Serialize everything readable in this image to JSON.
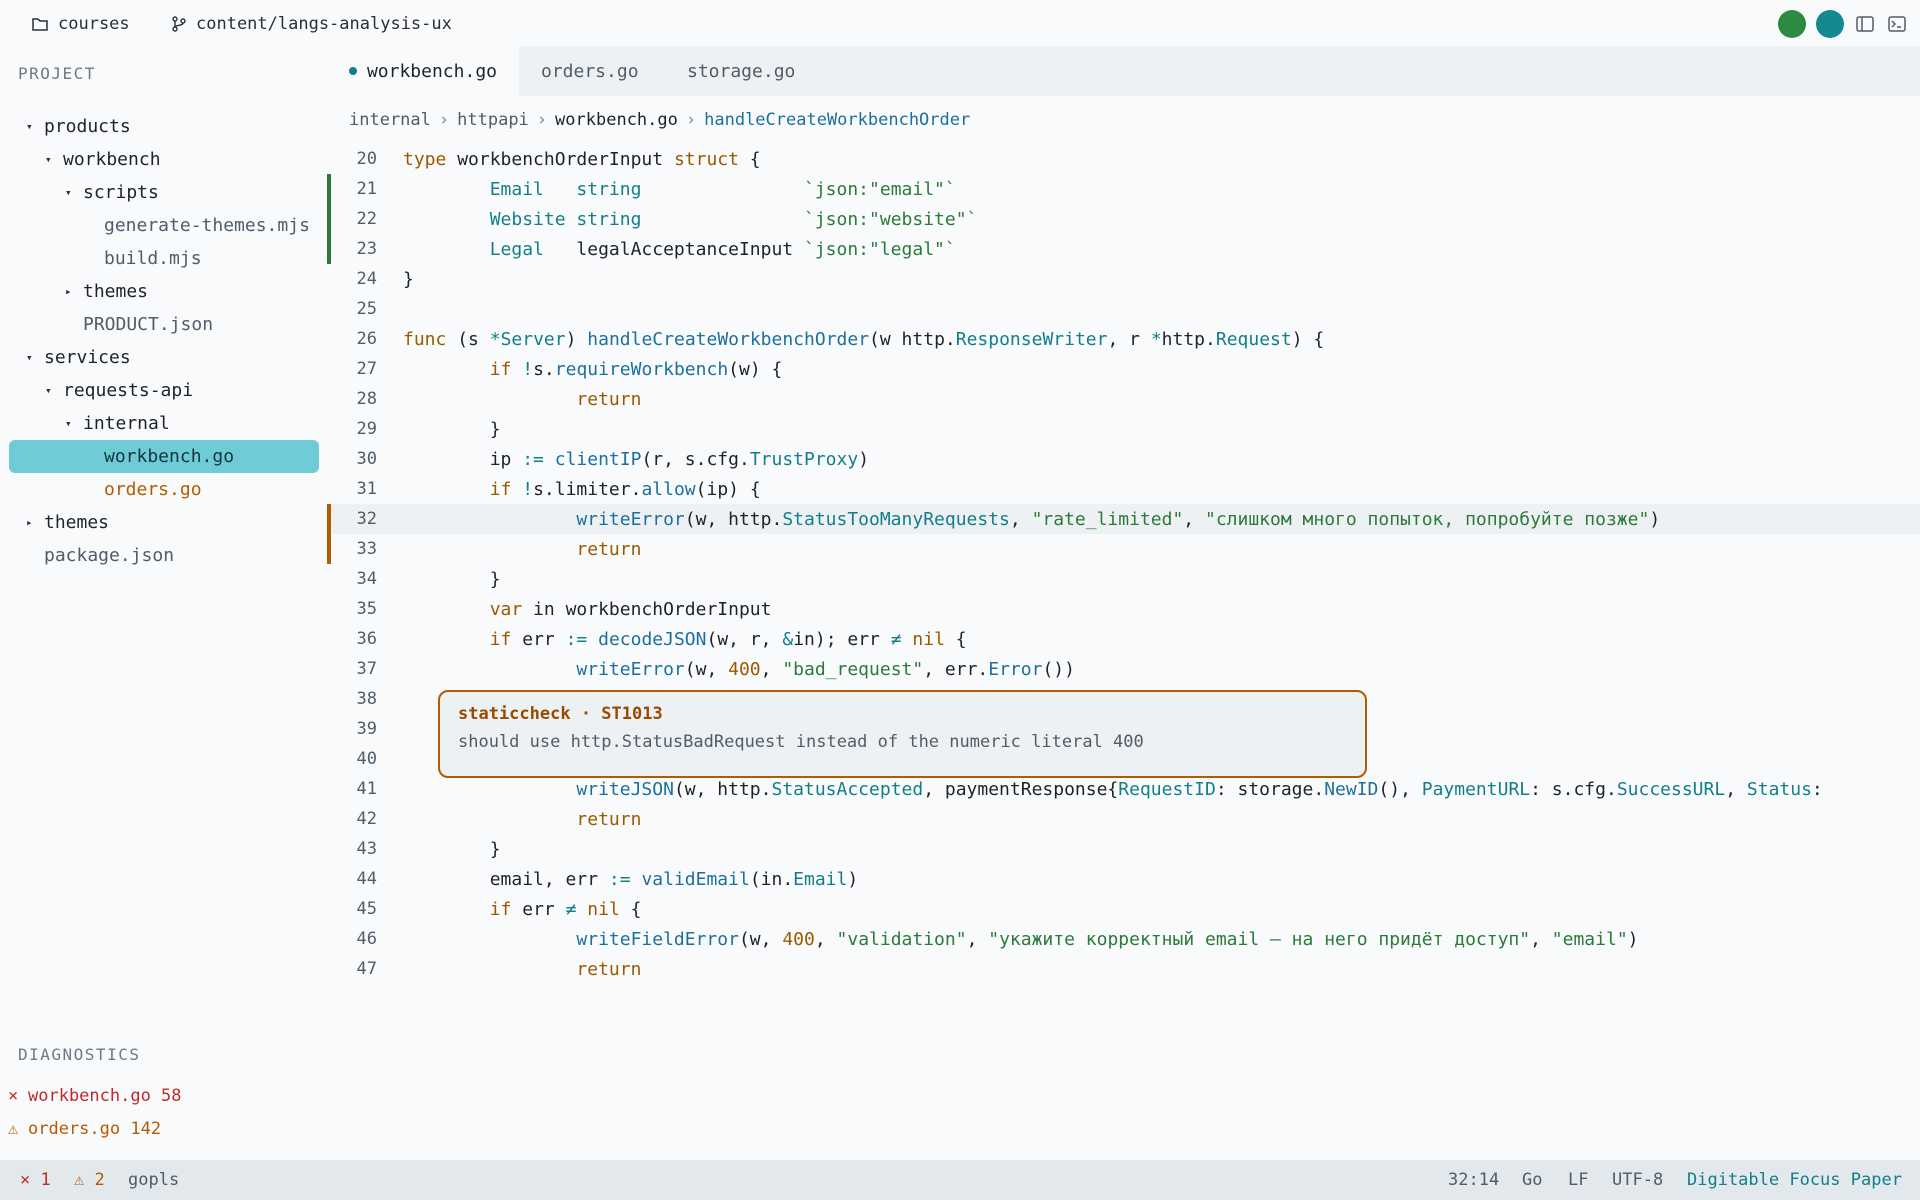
{
  "topbar": {
    "project": "courses",
    "branch": "content/langs-analysis-ux",
    "avatar_colors": [
      "#2e8a3e",
      "#138a92"
    ]
  },
  "sidebar": {
    "project_title": "PROJECT",
    "tree": [
      {
        "label": "products",
        "caret": "▾",
        "kind": "folder"
      },
      {
        "label": "workbench",
        "caret": "▾",
        "kind": "folder"
      },
      {
        "label": "scripts",
        "caret": "▾",
        "kind": "folder"
      },
      {
        "label": "generate-themes.mjs",
        "caret": "",
        "kind": "file"
      },
      {
        "label": "build.mjs",
        "caret": "",
        "kind": "file"
      },
      {
        "label": "themes",
        "caret": "▸",
        "kind": "folder"
      },
      {
        "label": "PRODUCT.json",
        "caret": "",
        "kind": "file"
      },
      {
        "label": "services",
        "caret": "▾",
        "kind": "folder"
      },
      {
        "label": "requests-api",
        "caret": "▾",
        "kind": "folder"
      },
      {
        "label": "internal",
        "caret": "▾",
        "kind": "folder"
      },
      {
        "label": "workbench.go",
        "caret": "",
        "kind": "selected"
      },
      {
        "label": "orders.go",
        "caret": "",
        "kind": "warn"
      },
      {
        "label": "themes",
        "caret": "▸",
        "kind": "folder"
      },
      {
        "label": "package.json",
        "caret": "",
        "kind": "file"
      }
    ],
    "diagnostics_title": "DIAGNOSTICS",
    "diagnostics": [
      {
        "symbol": "×",
        "text": "workbench.go 58",
        "severity": "error"
      },
      {
        "symbol": "⚠",
        "text": "orders.go 142",
        "severity": "warning"
      }
    ]
  },
  "tabs": [
    {
      "label": "workbench.go",
      "active": true,
      "modified": true
    },
    {
      "label": "orders.go",
      "active": false,
      "modified": false
    },
    {
      "label": "storage.go",
      "active": false,
      "modified": false
    }
  ],
  "breadcrumb": {
    "parts": [
      "internal",
      "httpapi",
      "workbench.go"
    ],
    "symbol": "handleCreateWorkbenchOrder",
    "sep": "›"
  },
  "code_lines": [
    {
      "n": 20,
      "tokens": [
        [
          "kw",
          "type"
        ],
        [
          "pl",
          " workbenchOrderInput "
        ],
        [
          "kw",
          "struct"
        ],
        [
          "pl",
          " {"
        ]
      ]
    },
    {
      "n": 21,
      "mark": "added",
      "tokens": [
        [
          "pl",
          "        "
        ],
        [
          "ty",
          "Email"
        ],
        [
          "pl",
          "   "
        ],
        [
          "ty",
          "string"
        ],
        [
          "pl",
          "               "
        ],
        [
          "st",
          "`json:\"email\"`"
        ]
      ]
    },
    {
      "n": 22,
      "mark": "added",
      "tokens": [
        [
          "pl",
          "        "
        ],
        [
          "ty",
          "Website"
        ],
        [
          "pl",
          " "
        ],
        [
          "ty",
          "string"
        ],
        [
          "pl",
          "               "
        ],
        [
          "st",
          "`json:\"website\"`"
        ]
      ]
    },
    {
      "n": 23,
      "mark": "added",
      "tokens": [
        [
          "pl",
          "        "
        ],
        [
          "ty",
          "Legal"
        ],
        [
          "pl",
          "   legalAcceptanceInput "
        ],
        [
          "st",
          "`json:\"legal\"`"
        ]
      ]
    },
    {
      "n": 24,
      "tokens": [
        [
          "pl",
          "}"
        ]
      ]
    },
    {
      "n": 25,
      "tokens": []
    },
    {
      "n": 26,
      "tokens": [
        [
          "kw",
          "func"
        ],
        [
          "pl",
          " (s "
        ],
        [
          "op",
          "*"
        ],
        [
          "ty",
          "Server"
        ],
        [
          "pl",
          ") "
        ],
        [
          "fn",
          "handleCreateWorkbenchOrder"
        ],
        [
          "pl",
          "(w http."
        ],
        [
          "ty",
          "ResponseWriter"
        ],
        [
          "pl",
          ", r "
        ],
        [
          "op",
          "*"
        ],
        [
          "pl",
          "http."
        ],
        [
          "ty",
          "Request"
        ],
        [
          "pl",
          ") {"
        ]
      ]
    },
    {
      "n": 27,
      "tokens": [
        [
          "pl",
          "        "
        ],
        [
          "kw",
          "if"
        ],
        [
          "pl",
          " "
        ],
        [
          "op",
          "!"
        ],
        [
          "pl",
          "s."
        ],
        [
          "fn",
          "requireWorkbench"
        ],
        [
          "pl",
          "(w) {"
        ]
      ]
    },
    {
      "n": 28,
      "tokens": [
        [
          "pl",
          "                "
        ],
        [
          "kw",
          "return"
        ]
      ]
    },
    {
      "n": 29,
      "tokens": [
        [
          "pl",
          "        }"
        ]
      ]
    },
    {
      "n": 30,
      "tokens": [
        [
          "pl",
          "        ip "
        ],
        [
          "op",
          ":="
        ],
        [
          "pl",
          " "
        ],
        [
          "fn",
          "clientIP"
        ],
        [
          "pl",
          "(r, s.cfg."
        ],
        [
          "ty",
          "TrustProxy"
        ],
        [
          "pl",
          ")"
        ]
      ]
    },
    {
      "n": 31,
      "tokens": [
        [
          "pl",
          "        "
        ],
        [
          "kw",
          "if"
        ],
        [
          "pl",
          " "
        ],
        [
          "op",
          "!"
        ],
        [
          "pl",
          "s.limiter."
        ],
        [
          "fn",
          "allow"
        ],
        [
          "pl",
          "(ip) {"
        ]
      ]
    },
    {
      "n": 32,
      "mark": "modified",
      "highlight": true,
      "tokens": [
        [
          "pl",
          "                "
        ],
        [
          "fn",
          "writeError"
        ],
        [
          "pl",
          "(w, http."
        ],
        [
          "ty",
          "StatusTooManyRequests"
        ],
        [
          "pl",
          ", "
        ],
        [
          "st",
          "\"rate_limited\""
        ],
        [
          "pl",
          ", "
        ],
        [
          "st",
          "\"слишком много попыток, попробуйте позже\""
        ],
        [
          "pl",
          ")"
        ]
      ]
    },
    {
      "n": 33,
      "mark": "modified",
      "tokens": [
        [
          "pl",
          "                "
        ],
        [
          "kw",
          "return"
        ]
      ]
    },
    {
      "n": 34,
      "tokens": [
        [
          "pl",
          "        }"
        ]
      ]
    },
    {
      "n": 35,
      "tokens": [
        [
          "pl",
          "        "
        ],
        [
          "kw",
          "var"
        ],
        [
          "pl",
          " in workbenchOrderInput"
        ]
      ]
    },
    {
      "n": 36,
      "tokens": [
        [
          "pl",
          "        "
        ],
        [
          "kw",
          "if"
        ],
        [
          "pl",
          " err "
        ],
        [
          "op",
          ":="
        ],
        [
          "pl",
          " "
        ],
        [
          "fn",
          "decodeJSON"
        ],
        [
          "pl",
          "(w, r, "
        ],
        [
          "op",
          "&"
        ],
        [
          "pl",
          "in); err "
        ],
        [
          "op",
          "≠"
        ],
        [
          "pl",
          " "
        ],
        [
          "kw",
          "nil"
        ],
        [
          "pl",
          " {"
        ]
      ]
    },
    {
      "n": 37,
      "tokens": [
        [
          "pl",
          "                "
        ],
        [
          "fn",
          "writeError"
        ],
        [
          "pl",
          "(w, "
        ],
        [
          "nu",
          "400"
        ],
        [
          "pl",
          ", "
        ],
        [
          "st",
          "\"bad_request\""
        ],
        [
          "pl",
          ", err."
        ],
        [
          "fn",
          "Error"
        ],
        [
          "pl",
          "())"
        ]
      ]
    },
    {
      "n": 38,
      "tokens": []
    },
    {
      "n": 39,
      "tokens": []
    },
    {
      "n": 40,
      "tokens": []
    },
    {
      "n": 41,
      "tokens": [
        [
          "pl",
          "                "
        ],
        [
          "fn",
          "writeJSON"
        ],
        [
          "pl",
          "(w, http."
        ],
        [
          "ty",
          "StatusAccepted"
        ],
        [
          "pl",
          ", paymentResponse{"
        ],
        [
          "ty",
          "RequestID"
        ],
        [
          "pl",
          ": storage."
        ],
        [
          "fn",
          "NewID"
        ],
        [
          "pl",
          "(), "
        ],
        [
          "ty",
          "PaymentURL"
        ],
        [
          "pl",
          ": s.cfg."
        ],
        [
          "ty",
          "SuccessURL"
        ],
        [
          "pl",
          ", "
        ],
        [
          "ty",
          "Status"
        ],
        [
          "pl",
          ":"
        ]
      ]
    },
    {
      "n": 42,
      "tokens": [
        [
          "pl",
          "                "
        ],
        [
          "kw",
          "return"
        ]
      ]
    },
    {
      "n": 43,
      "tokens": [
        [
          "pl",
          "        }"
        ]
      ]
    },
    {
      "n": 44,
      "tokens": [
        [
          "pl",
          "        email, err "
        ],
        [
          "op",
          ":="
        ],
        [
          "pl",
          " "
        ],
        [
          "fn",
          "validEmail"
        ],
        [
          "pl",
          "(in."
        ],
        [
          "ty",
          "Email"
        ],
        [
          "pl",
          ")"
        ]
      ]
    },
    {
      "n": 45,
      "tokens": [
        [
          "pl",
          "        "
        ],
        [
          "kw",
          "if"
        ],
        [
          "pl",
          " err "
        ],
        [
          "op",
          "≠"
        ],
        [
          "pl",
          " "
        ],
        [
          "kw",
          "nil"
        ],
        [
          "pl",
          " {"
        ]
      ]
    },
    {
      "n": 46,
      "tokens": [
        [
          "pl",
          "                "
        ],
        [
          "fn",
          "writeFieldError"
        ],
        [
          "pl",
          "(w, "
        ],
        [
          "nu",
          "400"
        ],
        [
          "pl",
          ", "
        ],
        [
          "st",
          "\"validation\""
        ],
        [
          "pl",
          ", "
        ],
        [
          "st",
          "\"укажите корректный email — на него придёт доступ\""
        ],
        [
          "pl",
          ", "
        ],
        [
          "st",
          "\"email\""
        ],
        [
          "pl",
          ")"
        ]
      ]
    },
    {
      "n": 47,
      "tokens": [
        [
          "pl",
          "                "
        ],
        [
          "kw",
          "return"
        ]
      ]
    }
  ],
  "tooltip": {
    "title": "staticcheck · ST1013",
    "message": "should use http.StatusBadRequest instead of the numeric literal 400"
  },
  "statusbar": {
    "errors": "× 1",
    "warnings": "⚠ 2",
    "server": "gopls",
    "position": "32:14",
    "language": "Go",
    "eol": "LF",
    "encoding": "UTF-8",
    "theme": "Digitable Focus Paper"
  },
  "colors": {
    "accent": "#127e8a",
    "selection": "#6fcbd6",
    "added": "#2c7a3a",
    "modified": "#b35b00",
    "error": "#c22a2a"
  }
}
